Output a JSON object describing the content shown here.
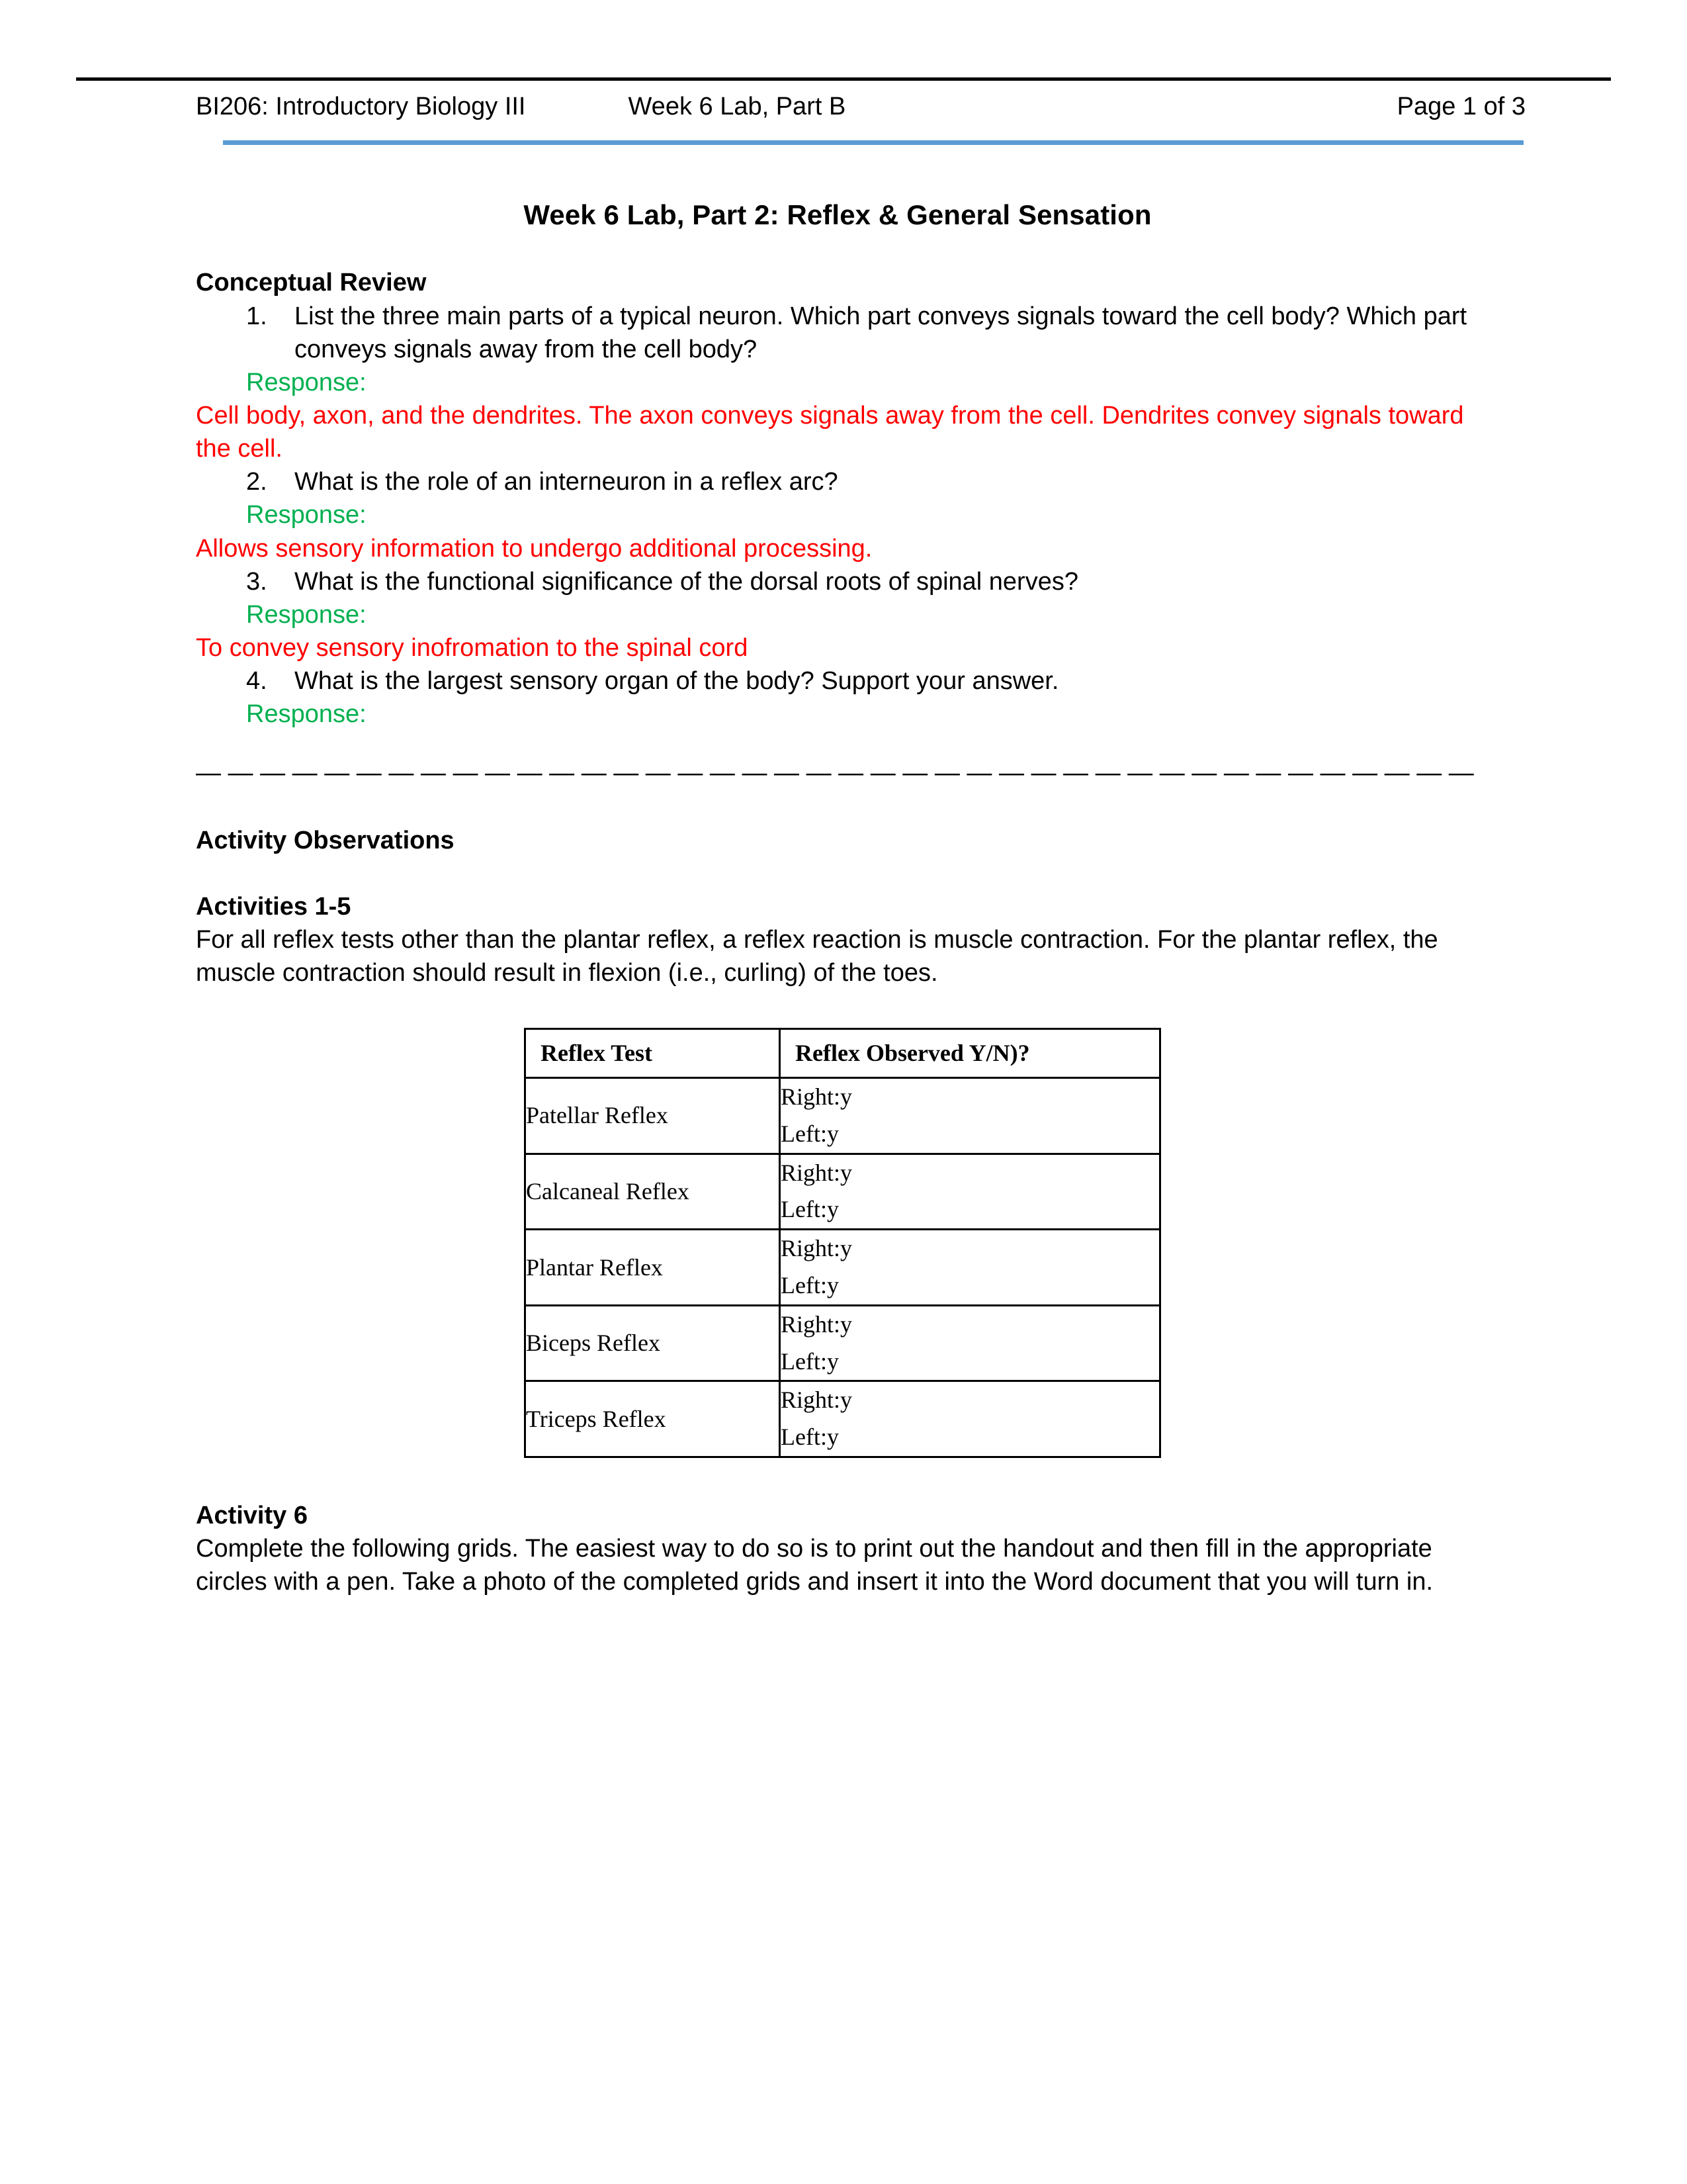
{
  "header": {
    "course": "BI206: Introductory Biology III",
    "lab": "Week 6 Lab, Part B",
    "page": "Page 1 of 3"
  },
  "colors": {
    "response_green": "#00B050",
    "answer_red": "#FF0000",
    "header_rule_blue": "#5B9BD5",
    "header_rule_black": "#000000"
  },
  "document": {
    "title": "Week 6 Lab, Part 2: Reflex & General Sensation"
  },
  "conceptual_review": {
    "heading": "Conceptual Review",
    "questions": [
      {
        "number": "1.",
        "text": "List the three main parts of a typical neuron. Which part conveys signals toward the cell body? Which part conveys signals away from the cell body?",
        "response_label": "Response:",
        "answer": "Cell body, axon, and the dendrites. The axon conveys signals away from the cell. Dendrites convey signals toward the cell."
      },
      {
        "number": "2.",
        "text": "What is the role of an interneuron in a reflex arc?",
        "response_label": "Response:",
        "answer": "Allows sensory information to undergo additional processing."
      },
      {
        "number": "3.",
        "text": "What is the functional significance of the dorsal roots of spinal nerves?",
        "response_label": "Response:",
        "answer": "To convey sensory inofromation to the spinal cord"
      },
      {
        "number": "4.",
        "text": "What is the largest sensory organ of the body? Support your answer.",
        "response_label": "Response:",
        "answer": ""
      }
    ]
  },
  "divider": "— — — — — — — — — — — — — — — — — — — — — — — — — — — — — — — — — — — — — — — — — — — — —",
  "activity_observations": {
    "heading": "Activity Observations",
    "activities_1_5": {
      "heading": "Activities 1-5",
      "intro": "For all reflex tests other than the plantar reflex, a reflex reaction is muscle contraction. For the plantar reflex, the muscle contraction should result in flexion (i.e., curling) of the toes.",
      "table": {
        "columns": [
          "Reflex Test",
          "Reflex Observed Y/N)?"
        ],
        "rows": [
          {
            "test": "Patellar Reflex",
            "right": "Right:y",
            "left": "Left:y"
          },
          {
            "test": "Calcaneal Reflex",
            "right": "Right:y",
            "left": "Left:y"
          },
          {
            "test": "Plantar Reflex",
            "right": "Right:y",
            "left": "Left:y"
          },
          {
            "test": "Biceps Reflex",
            "right": "Right:y",
            "left": "Left:y"
          },
          {
            "test": "Triceps Reflex",
            "right": "Right:y",
            "left": "Left:y"
          }
        ]
      }
    },
    "activity_6": {
      "heading": "Activity 6",
      "text": "Complete the following grids. The easiest way to do so is to print out the handout and then fill in the appropriate circles with a pen. Take a photo of the completed grids and insert it into the Word document that you will turn in."
    }
  }
}
